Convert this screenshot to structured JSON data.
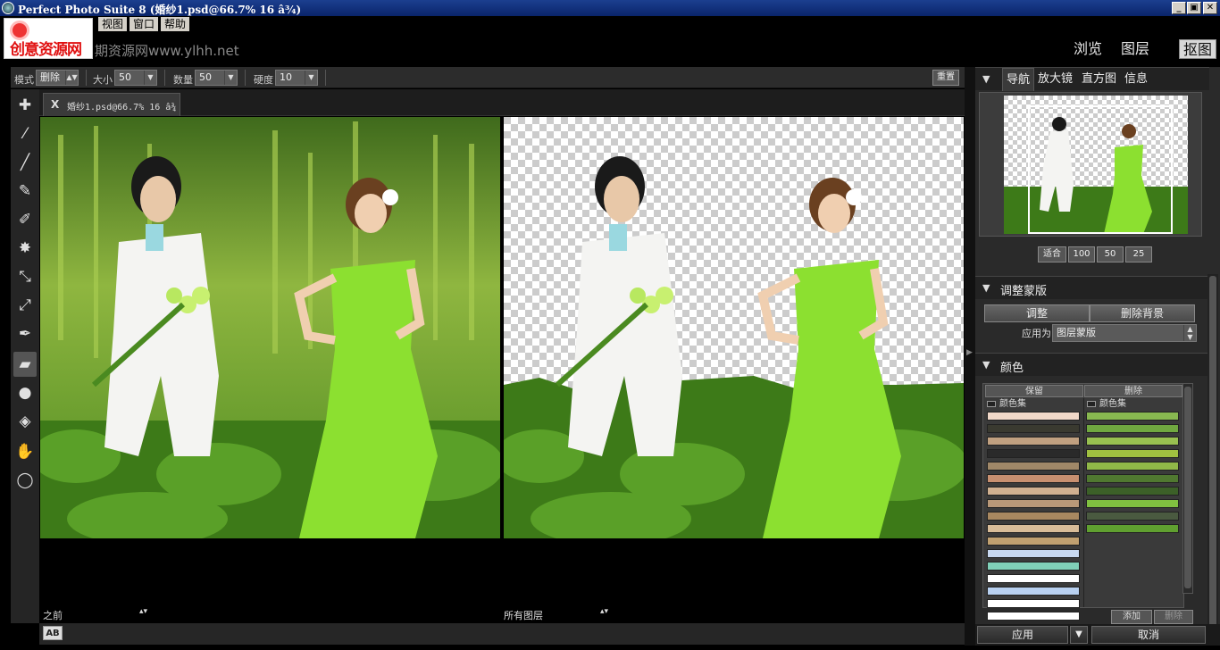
{
  "window": {
    "title": "Perfect Photo Suite 8 (婚纱1.psd@66.7% 16 â¾)",
    "min": "_",
    "max": "▣",
    "close": "✕"
  },
  "menu": [
    "视图",
    "窗口",
    "帮助"
  ],
  "overlay": {
    "logo_text": "创意资源网",
    "watermark": "期资源网www.ylhh.net"
  },
  "modes": {
    "browse": "浏览",
    "layers": "图层",
    "mask": "抠图"
  },
  "options": {
    "mode_label": "模式",
    "mode_value": "删除",
    "size_label": "大小",
    "size_value": "50",
    "amount_label": "数量",
    "amount_value": "50",
    "hardness_label": "硬度",
    "hardness_value": "10",
    "reset": "重置"
  },
  "tools": [
    "keep-brush-icon",
    "remove-brush-icon",
    "edge-brush-icon",
    "keep-pen-icon",
    "remove-pen-icon",
    "splat-icon",
    "keep-dropper-icon",
    "remove-dropper-icon",
    "pen-icon",
    "chisel-brush-icon",
    "drop-icon",
    "bucket-icon",
    "hand-icon",
    "zoom-icon"
  ],
  "document": {
    "close": "X",
    "tab": "婚纱1.psd@66.7% 16 â¾"
  },
  "views": {
    "left_label": "之前",
    "right_label": "所有图层",
    "ab": "AB"
  },
  "navigator": {
    "tabs": [
      "导航",
      "放大镜",
      "直方图",
      "信息"
    ],
    "zoom": [
      "适合",
      "100",
      "50",
      "25"
    ]
  },
  "refine": {
    "title": "调整蒙版",
    "adjust": "调整",
    "remove_bg": "删除背景",
    "apply_as_label": "应用为",
    "apply_as_value": "图层蒙版"
  },
  "colors": {
    "title": "颜色",
    "keep_header": "保留",
    "remove_header": "删除",
    "keep_set": "颜色集",
    "remove_set": "颜色集",
    "keep_swatches": [
      "#f0d8c8",
      "#3a3a30",
      "#c0a080",
      "#2a2a2a",
      "#a08868",
      "#c89070",
      "#d0b090",
      "#b89878",
      "#a88860",
      "#d8bc98",
      "#c0a070",
      "#c8d8f0",
      "#80d0b8",
      "#ffffff",
      "#b8d0f0",
      "#ffffff",
      "#ffffff"
    ],
    "remove_swatches": [
      "#88b850",
      "#70a840",
      "#98c050",
      "#a0c040",
      "#90b848",
      "#507830",
      "#3c6028",
      "#80c040",
      "#4a5a40",
      "#60a030"
    ],
    "add": "添加",
    "delete": "删除"
  },
  "footer": {
    "apply": "应用",
    "cancel": "取消"
  }
}
